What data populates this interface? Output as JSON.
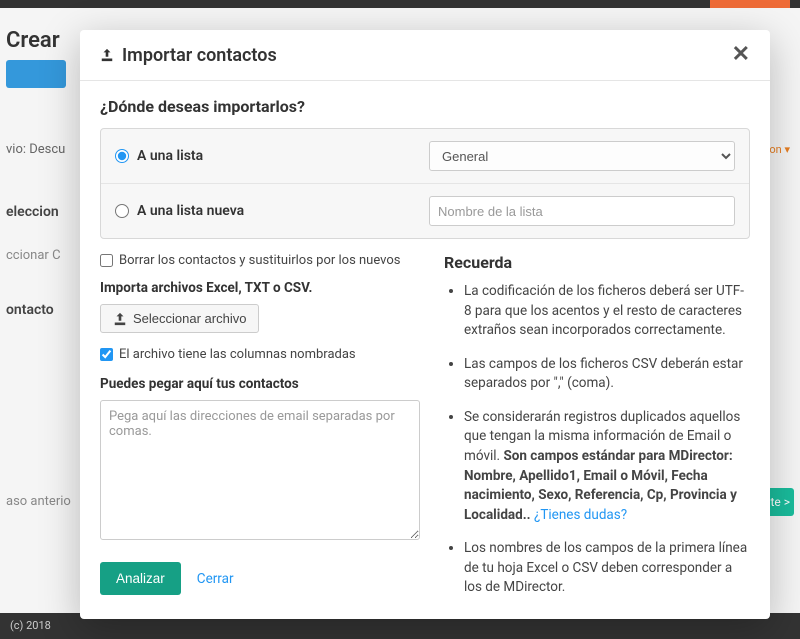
{
  "background": {
    "page_title": "Crear",
    "side_label_envio": "vio: Descu",
    "side_label_seleccion": "eleccion",
    "side_label_seleccionar": "ccionar C",
    "side_label_contactos": "ontacto",
    "step_prev": "aso anterio",
    "step_next_label": "te >",
    "dropdown_chevron": "on ▾",
    "footer_text": "(c) 2018"
  },
  "modal": {
    "title": "Importar contactos",
    "where_title": "¿Dónde deseas importarlos?",
    "radio_existing": "A una lista",
    "radio_new": "A una lista nueva",
    "list_select_value": "General",
    "new_list_placeholder": "Nombre de la lista",
    "delete_replace_label": "Borrar los contactos y sustituirlos por los nuevos",
    "import_files_label": "Importa archivos Excel, TXT o CSV.",
    "select_file_button": "Seleccionar archivo",
    "cols_named_label": "El archivo tiene las columnas nombradas",
    "paste_label": "Puedes pegar aquí tus contactos",
    "paste_placeholder": "Pega aquí las direcciones de email separadas por comas.",
    "analyze_button": "Analizar",
    "close_link": "Cerrar"
  },
  "remember": {
    "title": "Recuerda",
    "item1": "La codificación de los ficheros deberá ser UTF-8 para que los acentos y el resto de caracteres extraños sean incorporados correctamente.",
    "item2": "Las campos de los ficheros CSV deberán estar separados por \",\" (coma).",
    "item3_lead": "Se considerarán registros duplicados aquellos que tengan la misma información de Email o móvil. ",
    "item3_bold": "Son campos estándar para MDirector: Nombre, Apellido1, Email o Móvil, Fecha nacimiento, Sexo, Referencia, Cp, Provincia y Localidad..",
    "item3_link": " ¿Tienes dudas?",
    "item4": "Los nombres de los campos de la primera línea de tu hoja Excel o CSV deben corresponder a los de MDirector."
  }
}
